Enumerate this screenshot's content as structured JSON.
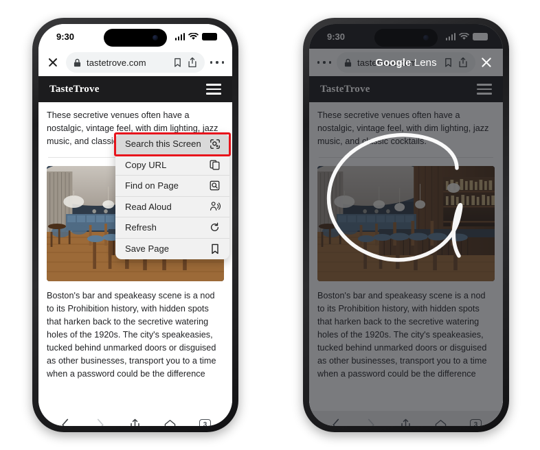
{
  "status_bar": {
    "time": "9:30",
    "signal_icon": "cellular-bars-icon",
    "wifi_icon": "wifi-icon",
    "battery_icon": "battery-icon"
  },
  "left_phone": {
    "browser": {
      "close_icon": "close-icon",
      "lock_icon": "lock-icon",
      "url": "tastetrove.com",
      "bookmark_icon": "bookmark-icon",
      "share_icon": "share-icon",
      "more_icon": "more-options-icon"
    },
    "site": {
      "logo": "TasteTrove",
      "menu_icon": "hamburger-menu-icon",
      "paragraph_top": "These secretive venues often have a nostalgic, vintage feel, with dim lighting, jazz music, and classic cocktails.",
      "image_alt": "speakeasy-bar-interior",
      "paragraph_bottom": "Boston's bar and speakeasy scene is a nod to its Prohibition history, with hidden spots that harken back to the secretive watering holes of the 1920s. The city's speakeasies, tucked behind unmarked doors or disguised as other businesses, transport you to a time when a password could be the difference"
    },
    "context_menu": {
      "items": [
        {
          "label": "Search this Screen",
          "icon": "google-lens-icon",
          "highlighted": true
        },
        {
          "label": "Copy URL",
          "icon": "copy-icon",
          "highlighted": false
        },
        {
          "label": "Find on Page",
          "icon": "find-in-page-icon",
          "highlighted": false
        },
        {
          "label": "Read Aloud",
          "icon": "read-aloud-icon",
          "highlighted": false
        },
        {
          "label": "Refresh",
          "icon": "refresh-icon",
          "highlighted": false
        },
        {
          "label": "Save Page",
          "icon": "bookmark-icon",
          "highlighted": false
        }
      ]
    },
    "highlight_box_color": "#e8141c",
    "toolbar": {
      "back_icon": "back-arrow-icon",
      "forward_icon": "forward-arrow-icon",
      "share_icon": "share-icon",
      "home_icon": "home-icon",
      "tab_count": "3"
    }
  },
  "right_phone": {
    "lens": {
      "brand_primary": "Google",
      "brand_secondary": "Lens",
      "close_icon": "close-icon",
      "selection_icon": "lens-hand-drawn-circle"
    },
    "browser": {
      "more_icon": "more-options-icon",
      "close_icon": "close-icon",
      "lock_icon": "lock-icon",
      "url": "tastetrove.com",
      "bookmark_icon": "bookmark-icon",
      "share_icon": "share-icon"
    },
    "site": {
      "logo": "TasteTrove",
      "menu_icon": "hamburger-menu-icon",
      "paragraph_top": "These secretive venues often have a nostalgic, vintage feel, with dim lighting, jazz music, and classic cocktails.",
      "image_alt": "speakeasy-bar-interior",
      "paragraph_bottom": "Boston's bar and speakeasy scene is a nod to its Prohibition history, with hidden spots that harken back to the secretive watering holes of the 1920s. The city's speakeasies, tucked behind unmarked doors or disguised as other businesses, transport you to a time when a password could be the difference"
    },
    "toolbar": {
      "back_icon": "back-arrow-icon",
      "forward_icon": "forward-arrow-icon",
      "share_icon": "share-icon",
      "home_icon": "home-icon",
      "tab_count": "3"
    }
  }
}
